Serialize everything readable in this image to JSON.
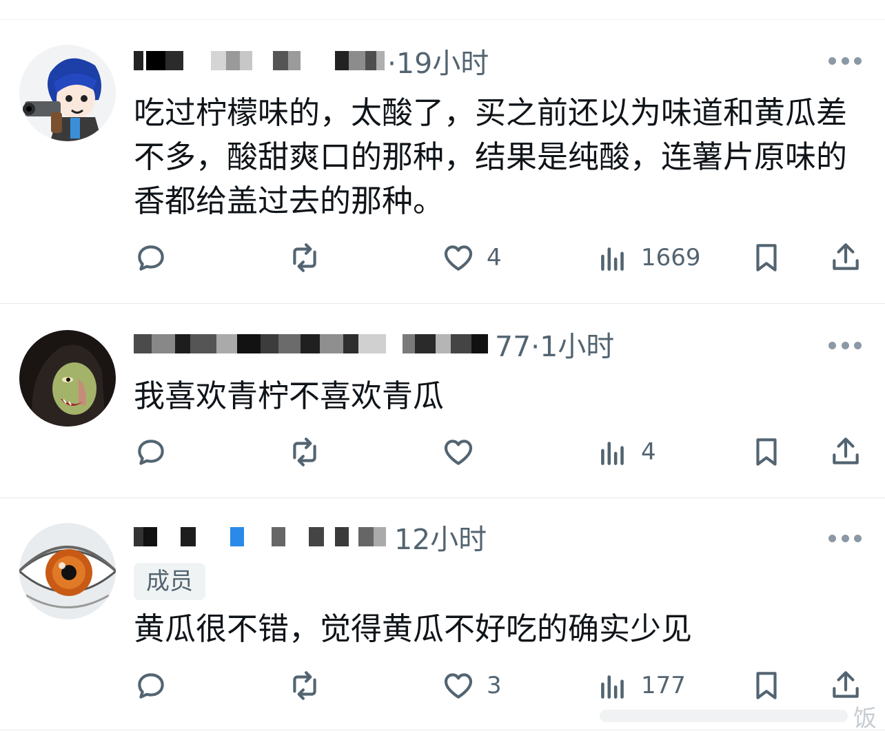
{
  "posts": [
    {
      "time": "·19小时",
      "text": "吃过柠檬味的，太酸了，买之前还以为味道和黄瓜差不多，酸甜爽口的那种，结果是纯酸，连薯片原味的香都给盖过去的那种。",
      "badge": "",
      "actions": {
        "reply": "",
        "repost": "",
        "like": "4",
        "views": "1669"
      }
    },
    {
      "time": "77·1小时",
      "text": "我喜欢青柠不喜欢青瓜",
      "badge": "",
      "actions": {
        "reply": "",
        "repost": "",
        "like": "",
        "views": "4"
      }
    },
    {
      "time": "12小时",
      "text": "黄瓜很不错，觉得黄瓜不好吃的确实少见",
      "badge": "成员",
      "actions": {
        "reply": "",
        "repost": "",
        "like": "3",
        "views": "177"
      }
    }
  ],
  "watermark": "饭",
  "colors": {
    "text": "#0f1419",
    "muted": "#536471",
    "divider": "#e6e9ea",
    "badge_bg": "#eff3f4"
  },
  "icons": [
    "reply-icon",
    "repost-icon",
    "like-icon",
    "views-icon",
    "bookmark-icon",
    "share-icon",
    "more-icon"
  ]
}
